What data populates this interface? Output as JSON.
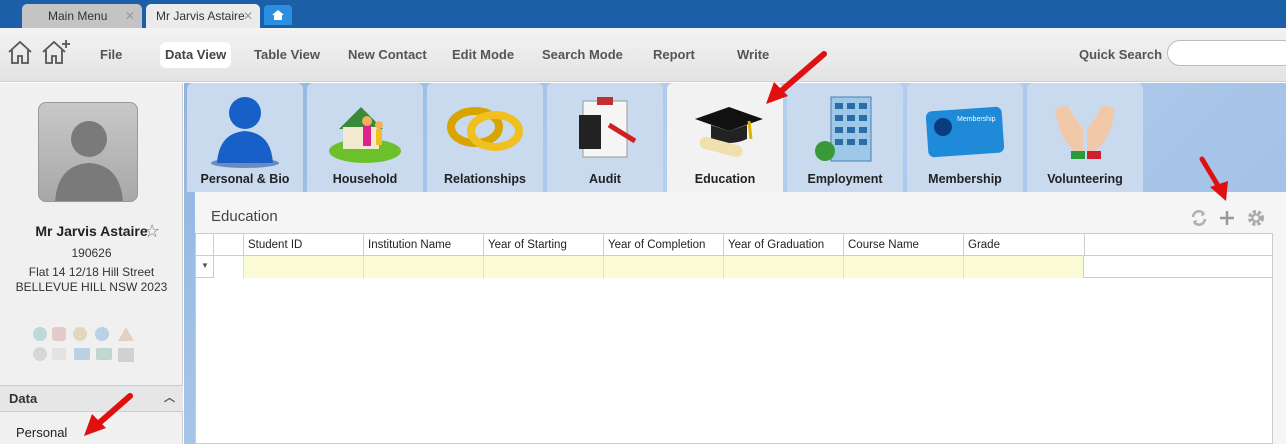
{
  "window_tabs": [
    {
      "label": "Main Menu",
      "close": "✕"
    },
    {
      "label": "Mr Jarvis Astaire",
      "close": "✕"
    }
  ],
  "toolbar": {
    "items": [
      "File",
      "Data View",
      "Table View",
      "New Contact",
      "Edit Mode",
      "Search Mode",
      "Report",
      "Write"
    ],
    "active": "Data View",
    "quick_search_label": "Quick Search",
    "quick_search_value": ""
  },
  "contact": {
    "name": "Mr Jarvis Astaire",
    "id": "190626",
    "address_line1": "Flat 14 12/18 Hill Street",
    "address_line2": "BELLEVUE HILL NSW 2023"
  },
  "left_nav": {
    "section": "Data",
    "items": [
      "Personal"
    ]
  },
  "module_tabs": [
    {
      "label": "Personal & Bio",
      "icon": "person-icon"
    },
    {
      "label": "Household",
      "icon": "household-icon"
    },
    {
      "label": "Relationships",
      "icon": "rings-icon"
    },
    {
      "label": "Audit",
      "icon": "clipboard-icon"
    },
    {
      "label": "Education",
      "icon": "graduation-cap-icon"
    },
    {
      "label": "Employment",
      "icon": "building-icon"
    },
    {
      "label": "Membership",
      "icon": "membership-card-icon"
    },
    {
      "label": "Volunteering",
      "icon": "hands-icon"
    }
  ],
  "active_module": "Education",
  "membership_card_text": "Membership",
  "education": {
    "title": "Education",
    "columns": [
      "Student ID",
      "Institution Name",
      "Year of Starting",
      "Year of Completion",
      "Year of Graduation",
      "Course Name",
      "Grade"
    ],
    "rows": []
  },
  "colors": {
    "titlebar": "#1b5fa8",
    "filter_row": "#fbfbd5",
    "annotation_arrow": "#e01010"
  }
}
